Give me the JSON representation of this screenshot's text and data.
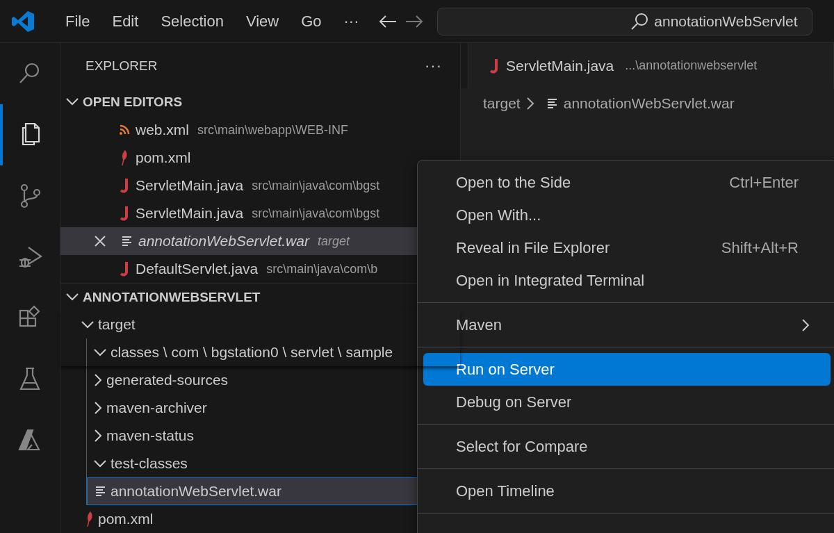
{
  "menu_bar": [
    "File",
    "Edit",
    "Selection",
    "View",
    "Go",
    "···"
  ],
  "search": {
    "value": "annotationWebServlet"
  },
  "activity_bar": [
    {
      "selected": false
    },
    {
      "selected": true
    },
    {
      "selected": false
    },
    {
      "selected": false
    },
    {
      "selected": false
    },
    {
      "selected": false
    },
    {
      "selected": false
    }
  ],
  "sidebar": {
    "title": "EXPLORER",
    "more": "···",
    "open_editors": {
      "title": "OPEN EDITORS",
      "expanded": true,
      "items": [
        {
          "kind": "xml",
          "name": "web.xml",
          "path": "src\\main\\webapp\\WEB-INF",
          "preview": false,
          "selected": false
        },
        {
          "kind": "maven",
          "name": "pom.xml",
          "preview": false,
          "selected": false
        },
        {
          "kind": "java",
          "name": "ServletMain.java",
          "path": "src\\main\\java\\com\\bgst",
          "preview": false,
          "selected": false
        },
        {
          "kind": "java",
          "name": "ServletMain.java",
          "path": "src\\main\\java\\com\\bgst",
          "preview": false,
          "selected": false
        },
        {
          "kind": "text",
          "name": "annotationWebServlet.war",
          "path": "target",
          "preview": true,
          "selected": true
        },
        {
          "kind": "java",
          "name": "DefaultServlet.java",
          "path": "src\\main\\java\\com\\b",
          "preview": false,
          "selected": false
        }
      ]
    },
    "project": {
      "title": "ANNOTATIONWEBSERVLET",
      "expanded": true,
      "tree": [
        {
          "kind": "folder",
          "name": "target",
          "expanded": true,
          "selected": false,
          "children": [
            {
              "kind": "folder",
              "name": "classes \\ com \\ bgstation0 \\ servlet \\ sample",
              "expanded": true,
              "selected": false
            },
            {
              "kind": "folder",
              "name": "generated-sources",
              "expanded": false,
              "selected": false
            },
            {
              "kind": "folder",
              "name": "maven-archiver",
              "expanded": false,
              "selected": false
            },
            {
              "kind": "folder",
              "name": "maven-status",
              "expanded": false,
              "selected": false
            },
            {
              "kind": "folder",
              "name": "test-classes",
              "expanded": true,
              "selected": false
            },
            {
              "kind": "text",
              "name": "annotationWebServlet.war",
              "selected": true
            }
          ]
        },
        {
          "kind": "maven",
          "name": "pom.xml",
          "selected": false
        }
      ]
    }
  },
  "editor": {
    "tab": {
      "kind": "java",
      "name": "ServletMain.java",
      "description": "...\\annotationwebservlet"
    },
    "breadcrumb": [
      {
        "kind": "folder",
        "label": "target"
      },
      {
        "kind": "text",
        "label": "annotationWebServlet.war"
      }
    ]
  },
  "context_menu": {
    "groups": [
      [
        {
          "label": "Open to the Side",
          "shortcut": "Ctrl+Enter",
          "submenu": false,
          "selected": false
        },
        {
          "label": "Open With...",
          "submenu": false,
          "selected": false
        },
        {
          "label": "Reveal in File Explorer",
          "shortcut": "Shift+Alt+R",
          "submenu": false,
          "selected": false
        },
        {
          "label": "Open in Integrated Terminal",
          "submenu": false,
          "selected": false
        }
      ],
      [
        {
          "label": "Maven",
          "submenu": true,
          "selected": false
        }
      ],
      [
        {
          "label": "Run on Server",
          "submenu": false,
          "selected": true
        },
        {
          "label": "Debug on Server",
          "submenu": false,
          "selected": false
        }
      ],
      [
        {
          "label": "Select for Compare",
          "submenu": false,
          "selected": false
        }
      ],
      [
        {
          "label": "Open Timeline",
          "submenu": false,
          "selected": false
        }
      ]
    ]
  }
}
